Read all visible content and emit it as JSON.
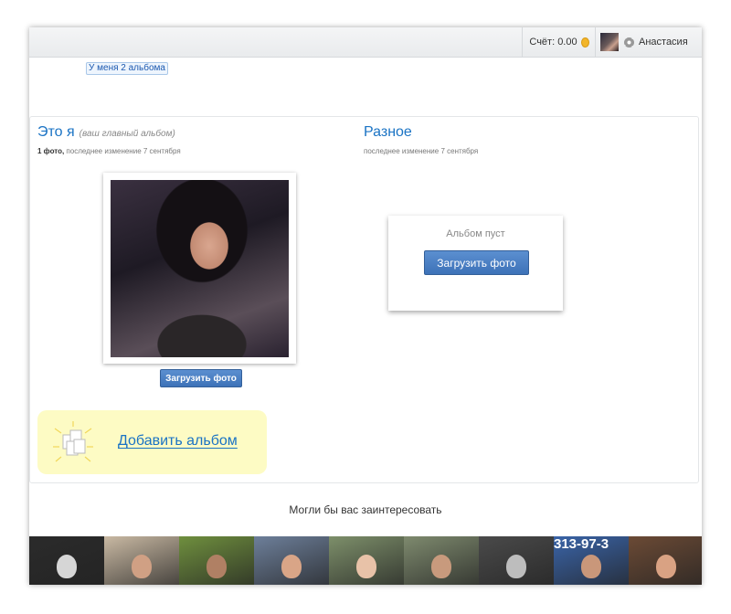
{
  "header": {
    "balance_label": "Счёт: 0.00",
    "coin_icon": "coin-icon",
    "settings_icon": "gear-icon",
    "user_name": "Анастасия"
  },
  "albums_count_link": "У меня 2 альбома",
  "albums": [
    {
      "title": "Это я",
      "note": "(ваш главный альбом)",
      "photo_count": "1 фото,",
      "modified": "последнее изменение 7 сентября",
      "upload_label": "Загрузить фото"
    },
    {
      "title": "Разное",
      "modified": "последнее изменение 7 сентября",
      "empty_text": "Альбом пуст",
      "upload_label": "Загрузить фото"
    }
  ],
  "add_album_label": "Добавить альбом",
  "suggest_title": "Могли бы вас заинтересовать",
  "suggested_people": [
    {
      "bg": "#2b2b2b",
      "skin": "#d6d6d6"
    },
    {
      "bg": "#c9b9a3",
      "skin": "#d0a084"
    },
    {
      "bg": "#6f8f3e",
      "skin": "#b08064"
    },
    {
      "bg": "#6d7f9a",
      "skin": "#d9a587"
    },
    {
      "bg": "#7d8f6a",
      "skin": "#e8c2a8"
    },
    {
      "bg": "#7e8a6e",
      "skin": "#c89a7d"
    },
    {
      "bg": "#4a4a4a",
      "skin": "#bdbdbd"
    },
    {
      "bg": "#3a64a8",
      "skin": "#c9977a",
      "text": "313-97-3"
    },
    {
      "bg": "#6b4a35",
      "skin": "#d9a283"
    }
  ]
}
